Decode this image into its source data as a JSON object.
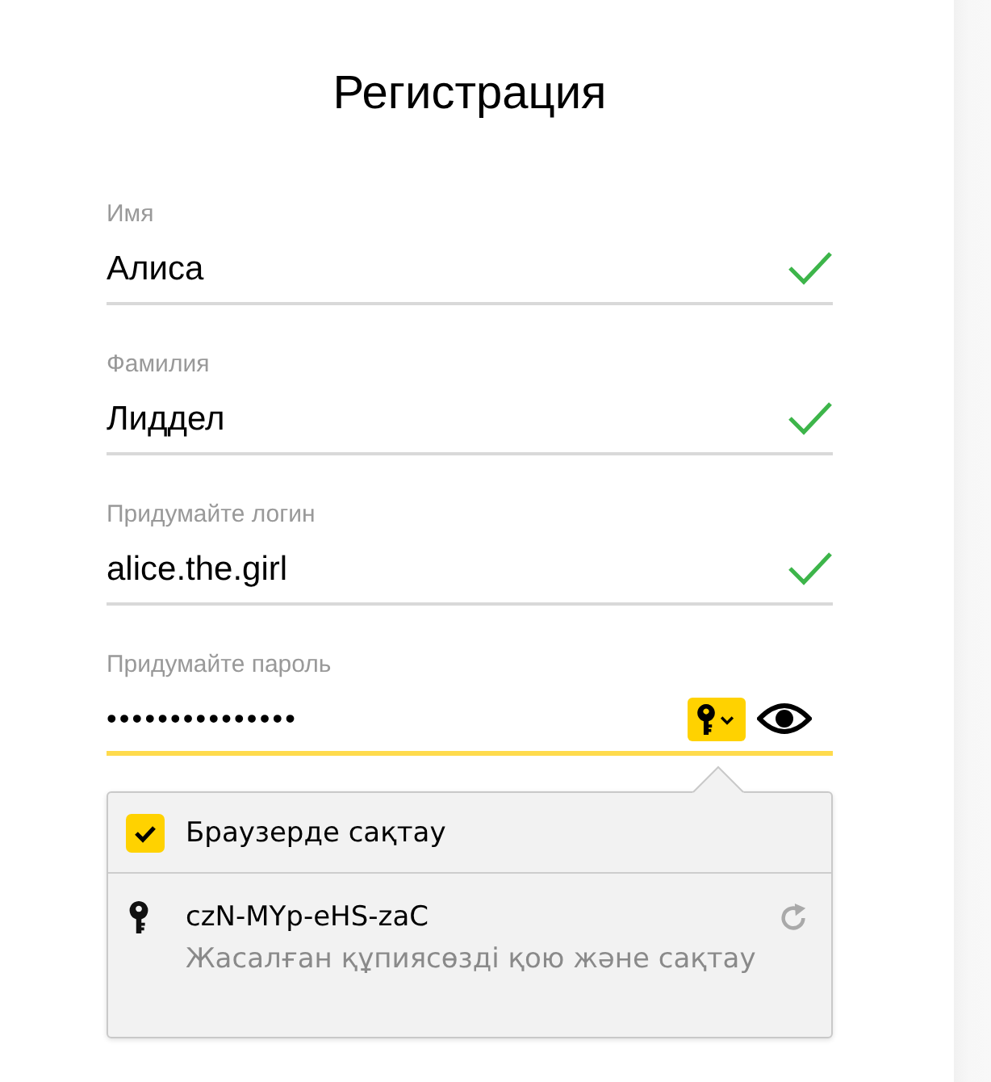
{
  "title": "Регистрация",
  "fields": [
    {
      "label": "Имя",
      "value": "Алиса",
      "kind": "text",
      "valid": true,
      "focused": false
    },
    {
      "label": "Фамилия",
      "value": "Лиддел",
      "kind": "text",
      "valid": true,
      "focused": false
    },
    {
      "label": "Придумайте логин",
      "value": "alice.the.girl",
      "kind": "text",
      "valid": true,
      "focused": false
    },
    {
      "label": "Придумайте пароль",
      "value": "•••••••••••••••",
      "kind": "password",
      "valid": false,
      "focused": true
    }
  ],
  "password_popup": {
    "save_option": {
      "label": "Браузерде сақтау",
      "checked": true
    },
    "suggestion": {
      "password": "czN-MYp-eHS-zaC",
      "hint": "Жасалған құпиясөзді қою және сақтау"
    }
  }
}
